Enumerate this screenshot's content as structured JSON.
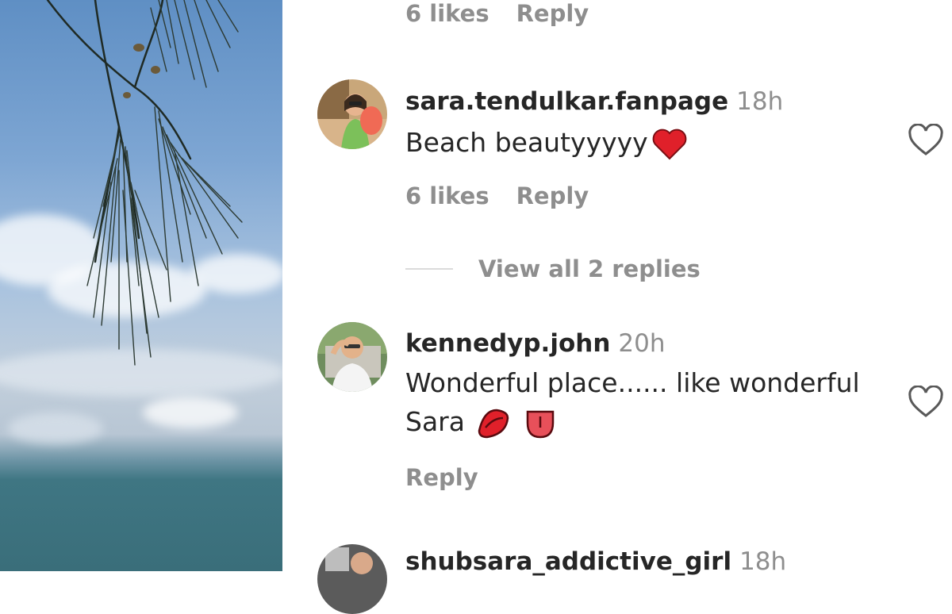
{
  "comments": [
    {
      "likes_label": "6 likes",
      "reply_label": "Reply"
    },
    {
      "username": "sara.tendulkar.fanpage",
      "time": "18h",
      "text": "Beach beautyyyyy",
      "emoji": [
        "red-heart"
      ],
      "likes_label": "6 likes",
      "reply_label": "Reply",
      "view_replies_label": "View all 2 replies"
    },
    {
      "username": "kennedyp.john",
      "time": "20h",
      "text_line1": "Wonderful place...... like wonderful",
      "text_line2": "Sara",
      "emoji": [
        "kiss-mark",
        "tongue"
      ],
      "reply_label": "Reply"
    },
    {
      "username": "shubsara_addictive_girl",
      "time": "18h"
    }
  ],
  "colors": {
    "text": "#262626",
    "secondary": "#8e8e8e",
    "heart_emoji": "#e0202a",
    "divider": "#dbdbdb"
  },
  "icons": [
    "heart-outline-icon"
  ]
}
